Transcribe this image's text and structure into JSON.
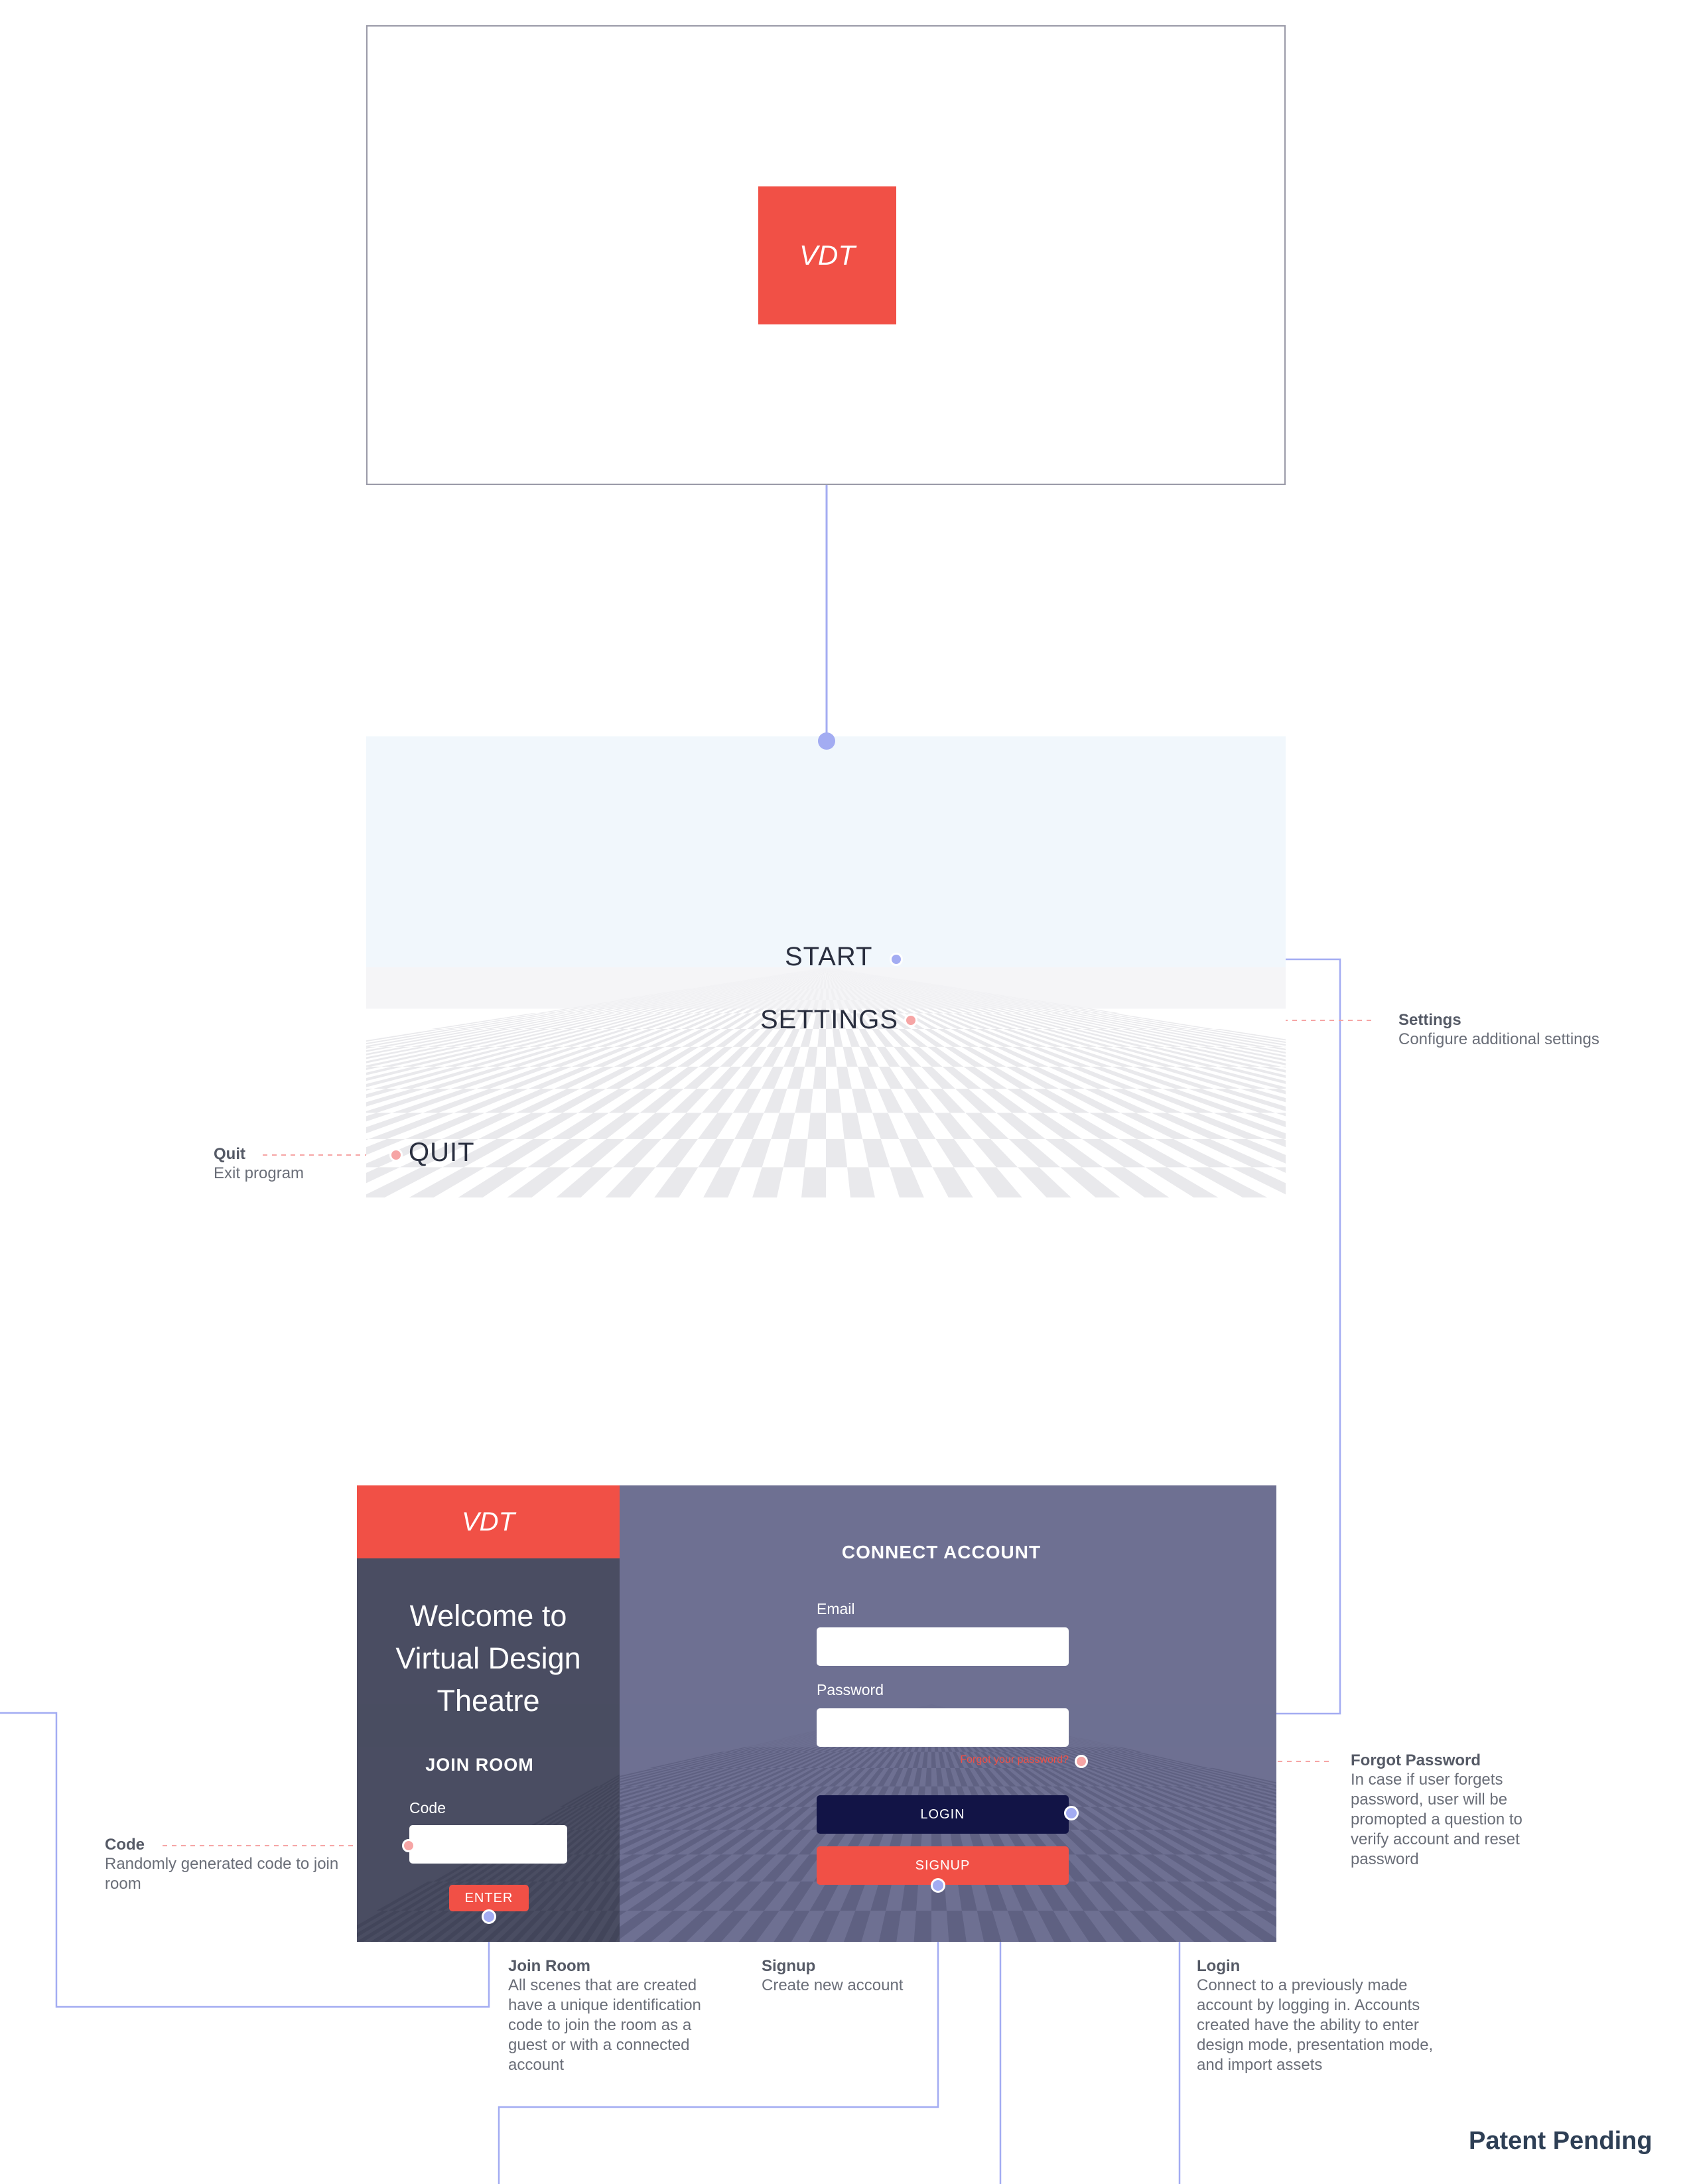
{
  "splash": {
    "logo_text": "VDT"
  },
  "menu": {
    "start_label": "START",
    "settings_label": "SETTINGS",
    "quit_label": "QUIT"
  },
  "login": {
    "logo_text": "VDT",
    "welcome_text": "Welcome to Virtual Design Theatre",
    "join_room_heading": "JOIN ROOM",
    "code_label": "Code",
    "enter_label": "ENTER",
    "connect_heading": "CONNECT ACCOUNT",
    "email_label": "Email",
    "password_label": "Password",
    "forgot_label": "Forgot your password?",
    "login_label": "LOGIN",
    "signup_label": "SIGNUP"
  },
  "annotations": {
    "settings": {
      "title": "Settings",
      "desc": "Configure additional settings"
    },
    "quit": {
      "title": "Quit",
      "desc": "Exit program"
    },
    "forgot": {
      "title": "Forgot Password",
      "desc": "In case if user forgets password, user will be promopted a question to verify account and reset password"
    },
    "code": {
      "title": "Code",
      "desc": "Randomly generated code to join room"
    },
    "join_room": {
      "title": "Join Room",
      "desc": "All scenes that are created have a unique identification code to join the room as a guest or with a connected account"
    },
    "signup": {
      "title": "Signup",
      "desc": "Create new account"
    },
    "login": {
      "title": "Login",
      "desc": "Connect to a previously made account by logging in. Accounts created have the ability to enter design mode, presentation mode, and import assets"
    }
  },
  "footer": {
    "patent": "Patent Pending"
  },
  "colors": {
    "accent_red": "#f15046",
    "connector_blue": "#a3acf2",
    "connector_pink": "#f6a5a5",
    "login_navy": "#121446",
    "panel_dark": "#4a4d62",
    "panel_purple": "#6e7092"
  }
}
